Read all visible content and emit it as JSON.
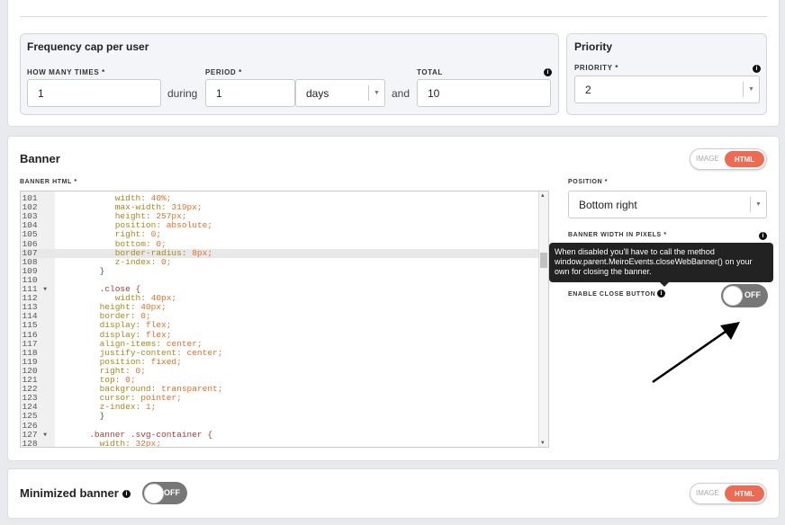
{
  "frequency": {
    "title": "Frequency cap per user",
    "how_many_label": "HOW MANY TIMES *",
    "how_many_value": "1",
    "during": "during",
    "period_label": "PERIOD *",
    "period_value": "1",
    "period_unit": "days",
    "and": "and",
    "total_label": "TOTAL",
    "total_value": "10"
  },
  "priority": {
    "title": "Priority",
    "label": "PRIORITY *",
    "value": "2"
  },
  "banner": {
    "title": "Banner",
    "mode_image": "IMAGE",
    "mode_html": "HTML",
    "html_label": "BANNER HTML *",
    "position_label": "POSITION *",
    "position_value": "Bottom right",
    "width_label": "BANNER WIDTH IN PIXELS *",
    "tooltip": "When disabled you'll have to call the method window.parent.MeiroEvents.closeWebBanner() on your own for closing the banner.",
    "close_label": "ENABLE CLOSE BUTTON",
    "close_state": "OFF",
    "code_start": 101,
    "active_line": 107,
    "code": [
      "           width: 40%;",
      "           max-width: 319px;",
      "           height: 257px;",
      "           position: absolute;",
      "           right: 0;",
      "           bottom: 0;",
      "           border-radius: 8px;",
      "           z-index: 0;",
      "        }",
      "",
      "        .close {",
      "           width: 40px;",
      "        height: 40px;",
      "        border: 0;",
      "        display: flex;",
      "        display: flex;",
      "        align-items: center;",
      "        justify-content: center;",
      "        position: fixed;",
      "        right: 0;",
      "        top: 0;",
      "        background: transparent;",
      "        cursor: pointer;",
      "        z-index: 1;",
      "        }",
      "",
      "      .banner .svg-container {",
      "        width: 32px;"
    ],
    "folds": [
      111,
      127
    ]
  },
  "minimized": {
    "title": "Minimized banner",
    "state": "OFF",
    "mode_image": "IMAGE",
    "mode_html": "HTML"
  },
  "colors": {
    "accent": "#ef6a52",
    "toggle_off": "#777777"
  }
}
